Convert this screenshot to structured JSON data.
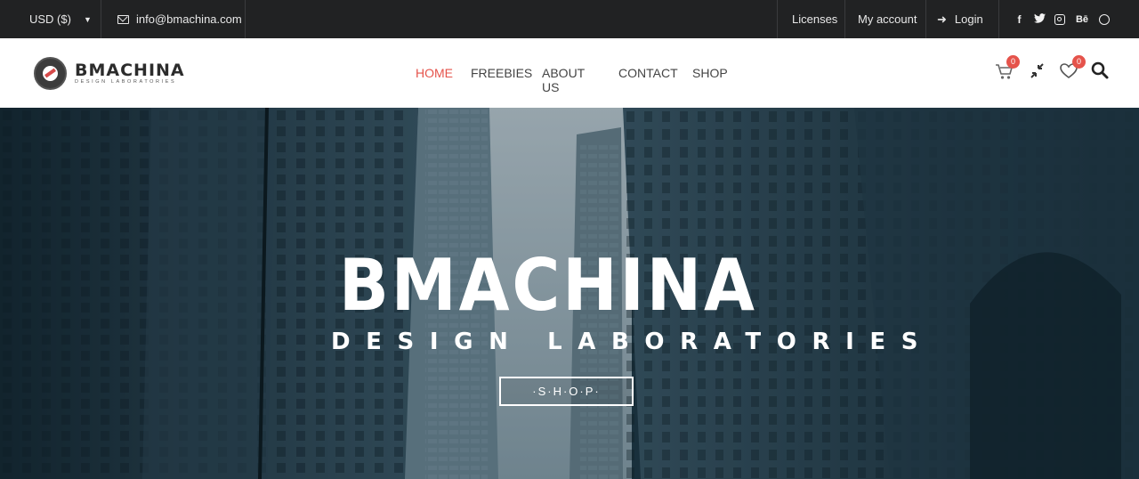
{
  "topbar": {
    "currency": "USD ($)",
    "email": "info@bmachina.com",
    "licenses": "Licenses",
    "my_account": "My account",
    "login": "Login",
    "social": {
      "facebook": "f",
      "twitter": "🐦",
      "behance": "Bē"
    }
  },
  "header": {
    "logo_name": "BMACHINA",
    "logo_tagline": "DESIGN LABORATORIES",
    "nav": [
      {
        "label": "HOME",
        "active": true
      },
      {
        "label": "FREEBIES"
      },
      {
        "label": "ABOUT US"
      },
      {
        "label": "CONTACT"
      },
      {
        "label": "SHOP"
      }
    ],
    "cart_count": "0",
    "wishlist_count": "0"
  },
  "hero": {
    "title": "BMACHINA",
    "subtitle": "DESIGN LABORATORIES",
    "button": "·S·H·O·P·"
  },
  "colors": {
    "accent": "#e5534b",
    "topbar_bg": "#212223",
    "hero_tint": "#1d3440"
  },
  "icons": [
    "caret-down-icon",
    "envelope-icon",
    "login-icon",
    "facebook-icon",
    "twitter-icon",
    "instagram-icon",
    "behance-icon",
    "dribbble-icon",
    "cart-icon",
    "compare-icon",
    "heart-icon",
    "search-icon"
  ]
}
